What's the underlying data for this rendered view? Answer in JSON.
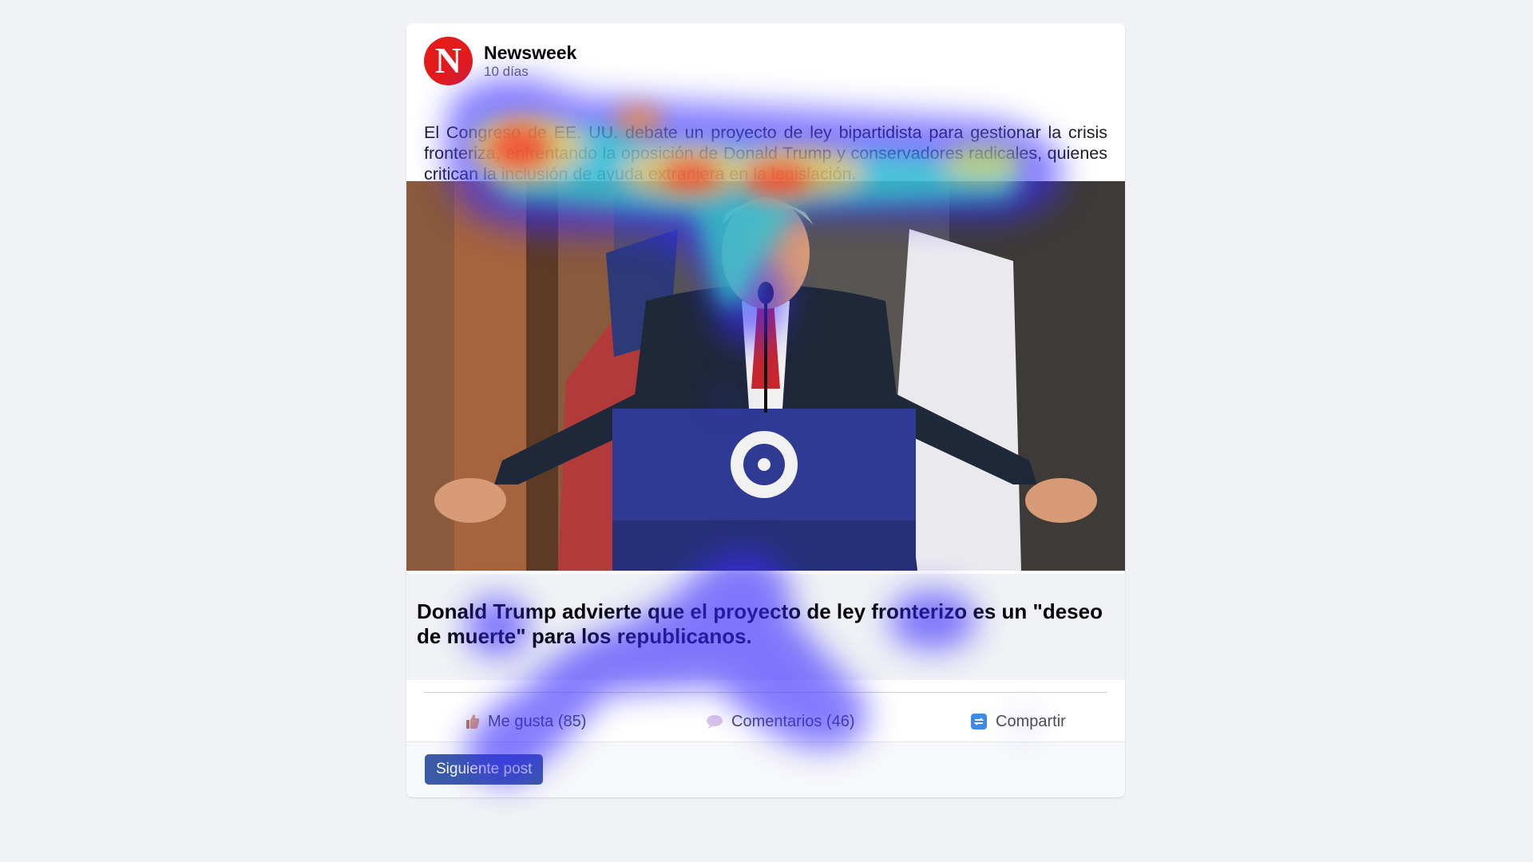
{
  "post": {
    "page_name": "Newsweek",
    "timestamp": "10 días",
    "logo_letter": "N",
    "text": "El Congreso de EE. UU. debate un proyecto de ley bipartidista para gestionar la crisis fronteriza, enfrentando la oposición de Donald Trump y conservadores radicales, quienes critican la inclusión de ayuda extranjera en la legislación.",
    "link_headline": "Donald Trump advierte que el proyecto de ley fronterizo es un \"deseo de muerte\" para los republicanos."
  },
  "actions": {
    "like_label": "Me gusta (85)",
    "comment_label": "Comentarios (46)",
    "share_label": "Compartir"
  },
  "footer": {
    "next_button_label": "Siguiente post"
  },
  "icons": {
    "like": "thumbs-up-icon",
    "comment": "speech-bubble-icon",
    "share": "share-icon"
  },
  "colors": {
    "logo_red": "#e41b1b",
    "button_blue": "#3b5ba7",
    "page_background": "#f0f2f5"
  }
}
